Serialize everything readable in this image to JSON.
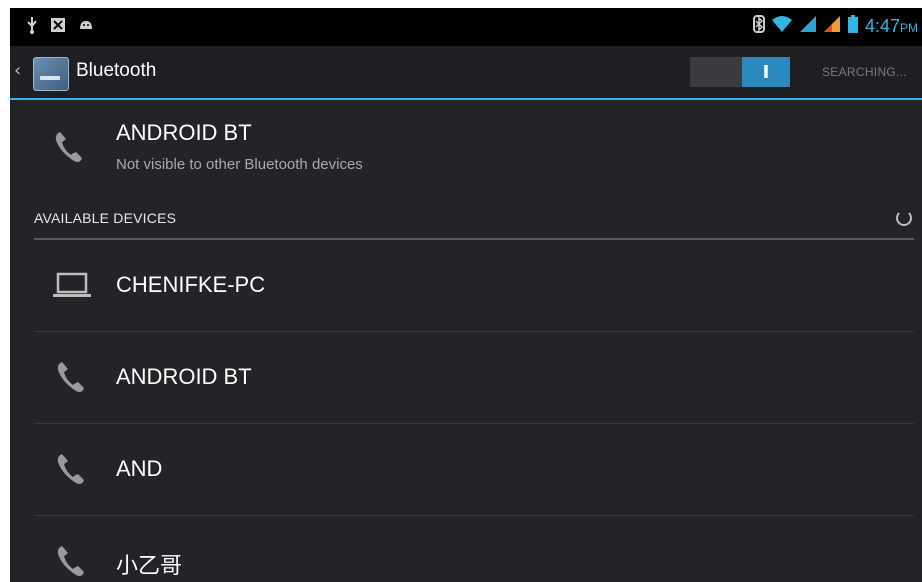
{
  "status_bar": {
    "time": "4:47",
    "ampm": "PM",
    "left_icons": [
      "usb-icon",
      "notification-icon",
      "android-debug-icon"
    ],
    "right_icons": [
      "bluetooth-icon",
      "wifi-icon",
      "signal-icon",
      "signal-icon-2",
      "battery-icon"
    ]
  },
  "action_bar": {
    "up_glyph": "‹",
    "title": "Bluetooth",
    "toggle_label": "I",
    "status": "SEARCHING..."
  },
  "my_device": {
    "name": "ANDROID BT",
    "subtitle": "Not visible to other Bluetooth devices",
    "icon": "phone-icon"
  },
  "available": {
    "header": "AVAILABLE DEVICES",
    "devices": [
      {
        "name": "CHENIFKE-PC",
        "icon": "laptop-icon"
      },
      {
        "name": "ANDROID BT",
        "icon": "phone-icon"
      },
      {
        "name": "AND",
        "icon": "phone-icon"
      },
      {
        "name": "小乙哥",
        "icon": "phone-icon"
      }
    ]
  },
  "colors": {
    "accent": "#33b5e5",
    "background": "#232427",
    "status_bar": "#000000"
  }
}
